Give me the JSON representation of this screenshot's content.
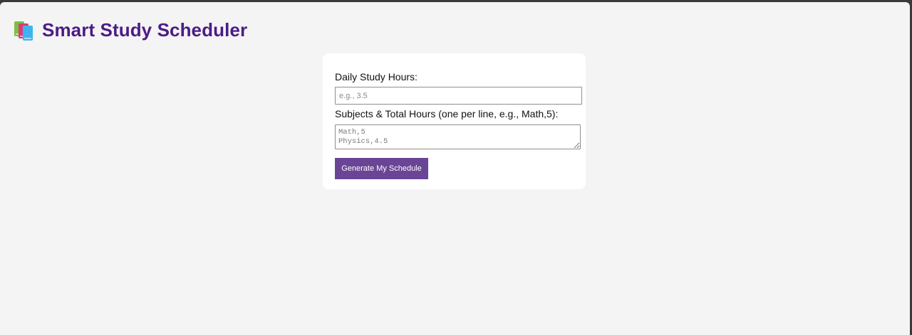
{
  "app": {
    "title": "Smart Study Scheduler",
    "icon": "books-icon"
  },
  "form": {
    "daily_hours_label": "Daily Study Hours:",
    "daily_hours_placeholder": "e.g., 3.5",
    "daily_hours_value": "",
    "subjects_label": "Subjects & Total Hours (one per line, e.g., Math,5):",
    "subjects_placeholder": "Math,5\nPhysics,4.5",
    "subjects_value": "",
    "generate_button": "Generate My Schedule"
  },
  "colors": {
    "title": "#4b1c87",
    "button": "#6a4596",
    "page_background": "#f4f4f4",
    "card_background": "#ffffff"
  }
}
